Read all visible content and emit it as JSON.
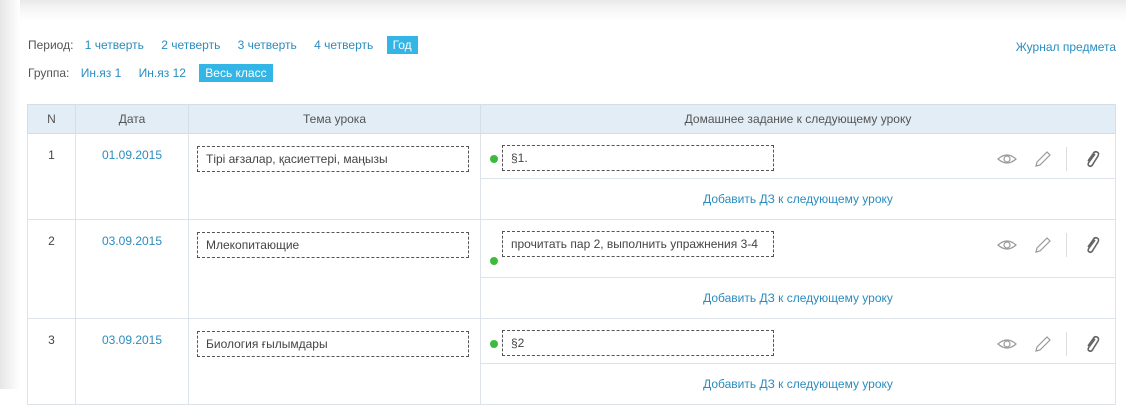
{
  "filters": {
    "period_label": "Период:",
    "period_options": [
      "1 четверть",
      "2 четверть",
      "3 четверть",
      "4 четверть",
      "Год"
    ],
    "period_active": "Год",
    "group_label": "Группа:",
    "group_options": [
      "Ин.яз 1",
      "Ин.яз 12",
      "Весь класс"
    ],
    "group_active": "Весь класс"
  },
  "journal_link": "Журнал предмета",
  "table": {
    "headers": [
      "N",
      "Дата",
      "Тема урока",
      "Домашнее задание к следующему уроку"
    ],
    "add_hw_label": "Добавить ДЗ к следующему уроку",
    "rows": [
      {
        "n": "1",
        "date": "01.09.2015",
        "topic": "Тірі ағзалар, қасиеттері, маңызы",
        "homework": "§1."
      },
      {
        "n": "2",
        "date": "03.09.2015",
        "topic": "Млекопитающие",
        "homework": "прочитать пар 2, выполнить упражнения 3-4"
      },
      {
        "n": "3",
        "date": "03.09.2015",
        "topic": "Биология ғылымдары",
        "homework": "§2"
      }
    ]
  },
  "colors": {
    "link": "#2a8cbf",
    "active_bg": "#33b5e5",
    "status_dot": "#3dbb3d",
    "header_bg": "#e2edf5"
  },
  "icons": [
    "eye-icon",
    "pencil-icon",
    "paperclip-icon"
  ]
}
